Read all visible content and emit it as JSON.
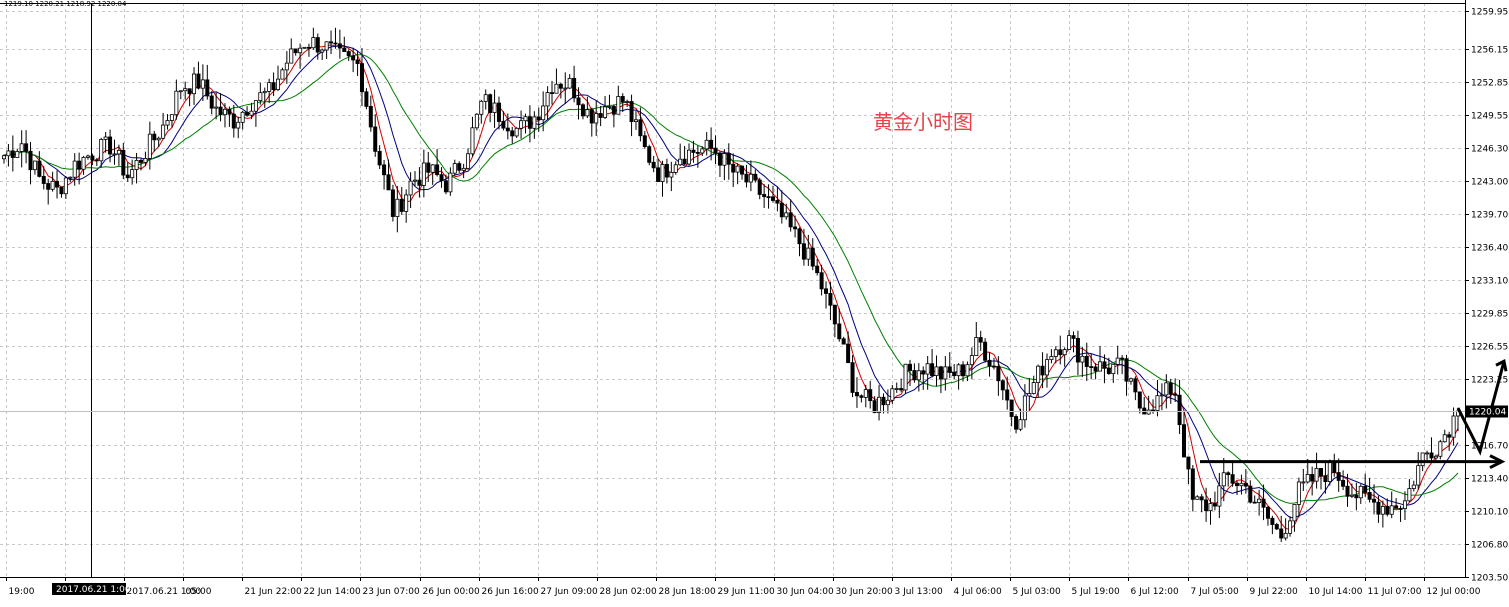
{
  "header_ohlc": "1219.10 1220.21 1218.92 1220.04",
  "chart_title": "黄金小时图",
  "current_price_label": "1220.04",
  "crosshair_time_label": "2017.06.21 1:00",
  "colors": {
    "candle": "#000000",
    "grid": "#c8c8c8",
    "ma_fast": "#cc0000",
    "ma_mid": "#000080",
    "ma_slow": "#008000",
    "title": "#e8434b"
  },
  "chart_data": {
    "type": "candlestick",
    "symbol": "XAUUSD",
    "timeframe": "H1",
    "y_axis": {
      "min": 1203.5,
      "max": 1260.7,
      "ticks": [
        "1259.95",
        "1256.15",
        "1252.85",
        "1249.55",
        "1246.30",
        "1243.00",
        "1239.70",
        "1236.40",
        "1233.10",
        "1229.85",
        "1226.55",
        "1223.25",
        "1220.04",
        "1216.70",
        "1213.40",
        "1210.10",
        "1206.80",
        "1203.50"
      ]
    },
    "x_axis": {
      "labels": [
        "19:00",
        "20",
        "2017.06.21 1:00",
        "05:00",
        "21 Jun 22:00",
        "22 Jun 14:00",
        "23 Jun 07:00",
        "26 Jun 00:00",
        "26 Jun 16:00",
        "27 Jun 09:00",
        "28 Jun 02:00",
        "28 Jun 18:00",
        "29 Jun 11:00",
        "30 Jun 04:00",
        "30 Jun 20:00",
        "3 Jul 13:00",
        "4 Jul 06:00",
        "5 Jul 03:00",
        "5 Jul 19:00",
        "6 Jul 12:00",
        "7 Jul 05:00",
        "9 Jul 22:00",
        "10 Jul 14:00",
        "11 Jul 07:00",
        "12 Jul 00:00"
      ]
    },
    "series": [
      {
        "name": "close",
        "points": [
          [
            "19 Jun 19:00",
            1245.5
          ],
          [
            "20 Jun 03:00",
            1246.8
          ],
          [
            "20 Jun 10:00",
            1243.2
          ],
          [
            "20 Jun 17:00",
            1242.0
          ],
          [
            "21 Jun 01:00",
            1244.6
          ],
          [
            "21 Jun 05:00",
            1245.8
          ],
          [
            "21 Jun 12:00",
            1246.5
          ],
          [
            "21 Jun 18:00",
            1243.4
          ],
          [
            "21 Jun 22:00",
            1246.0
          ],
          [
            "22 Jun 03:00",
            1248.5
          ],
          [
            "22 Jun 08:00",
            1252.4
          ],
          [
            "22 Jun 12:00",
            1252.8
          ],
          [
            "22 Jun 14:00",
            1250.0
          ],
          [
            "22 Jun 18:00",
            1249.0
          ],
          [
            "22 Jun 22:00",
            1251.0
          ],
          [
            "23 Jun 02:00",
            1251.8
          ],
          [
            "23 Jun 05:00",
            1255.0
          ],
          [
            "23 Jun 07:00",
            1256.9
          ],
          [
            "23 Jun 12:00",
            1256.5
          ],
          [
            "23 Jun 16:00",
            1255.2
          ],
          [
            "26 Jun 00:00",
            1254.5
          ],
          [
            "26 Jun 02:00",
            1246.0
          ],
          [
            "26 Jun 04:00",
            1239.5
          ],
          [
            "26 Jun 08:00",
            1243.0
          ],
          [
            "26 Jun 12:00",
            1244.0
          ],
          [
            "26 Jun 16:00",
            1242.6
          ],
          [
            "27 Jun 02:00",
            1245.5
          ],
          [
            "27 Jun 05:00",
            1251.0
          ],
          [
            "27 Jun 09:00",
            1249.5
          ],
          [
            "27 Jun 13:00",
            1248.0
          ],
          [
            "27 Jun 18:00",
            1249.5
          ],
          [
            "28 Jun 02:00",
            1253.0
          ],
          [
            "28 Jun 07:00",
            1252.5
          ],
          [
            "28 Jun 12:00",
            1249.5
          ],
          [
            "28 Jun 18:00",
            1250.5
          ],
          [
            "28 Jun 22:00",
            1251.0
          ],
          [
            "29 Jun 03:00",
            1246.5
          ],
          [
            "29 Jun 07:00",
            1243.5
          ],
          [
            "29 Jun 11:00",
            1245.5
          ],
          [
            "29 Jun 18:00",
            1246.0
          ],
          [
            "30 Jun 00:00",
            1246.2
          ],
          [
            "30 Jun 04:00",
            1244.0
          ],
          [
            "30 Jun 10:00",
            1242.8
          ],
          [
            "30 Jun 16:00",
            1241.2
          ],
          [
            "30 Jun 20:00",
            1239.0
          ],
          [
            "3 Jul 02:00",
            1236.5
          ],
          [
            "3 Jul 06:00",
            1233.0
          ],
          [
            "3 Jul 09:00",
            1228.0
          ],
          [
            "3 Jul 11:00",
            1222.0
          ],
          [
            "3 Jul 13:00",
            1220.5
          ],
          [
            "3 Jul 18:00",
            1222.0
          ],
          [
            "4 Jul 02:00",
            1224.0
          ],
          [
            "4 Jul 06:00",
            1224.5
          ],
          [
            "4 Jul 12:00",
            1223.5
          ],
          [
            "4 Jul 20:00",
            1224.0
          ],
          [
            "5 Jul 03:00",
            1227.0
          ],
          [
            "5 Jul 08:00",
            1224.0
          ],
          [
            "5 Jul 12:00",
            1219.0
          ],
          [
            "5 Jul 16:00",
            1222.5
          ],
          [
            "5 Jul 19:00",
            1226.0
          ],
          [
            "6 Jul 01:00",
            1227.2
          ],
          [
            "6 Jul 06:00",
            1225.0
          ],
          [
            "6 Jul 12:00",
            1224.3
          ],
          [
            "6 Jul 18:00",
            1224.5
          ],
          [
            "7 Jul 02:00",
            1220.5
          ],
          [
            "7 Jul 05:00",
            1221.0
          ],
          [
            "7 Jul 10:00",
            1222.5
          ],
          [
            "7 Jul 12:00",
            1211.0
          ],
          [
            "7 Jul 16:00",
            1210.5
          ],
          [
            "7 Jul 20:00",
            1213.5
          ],
          [
            "9 Jul 22:00",
            1212.5
          ],
          [
            "10 Jul 03:00",
            1210.0
          ],
          [
            "10 Jul 08:00",
            1207.5
          ],
          [
            "10 Jul 11:00",
            1212.0
          ],
          [
            "10 Jul 14:00",
            1213.5
          ],
          [
            "10 Jul 18:00",
            1214.3
          ],
          [
            "11 Jul 00:00",
            1212.0
          ],
          [
            "11 Jul 04:00",
            1211.0
          ],
          [
            "11 Jul 07:00",
            1210.5
          ],
          [
            "11 Jul 11:00",
            1211.0
          ],
          [
            "11 Jul 15:00",
            1215.5
          ],
          [
            "11 Jul 19:00",
            1217.0
          ],
          [
            "12 Jul 00:00",
            1220.04
          ]
        ]
      }
    ],
    "annotations": {
      "support_level": 1215.0,
      "arrow_up_target": 1225.0,
      "arrow_down_target": 1216.0
    }
  }
}
